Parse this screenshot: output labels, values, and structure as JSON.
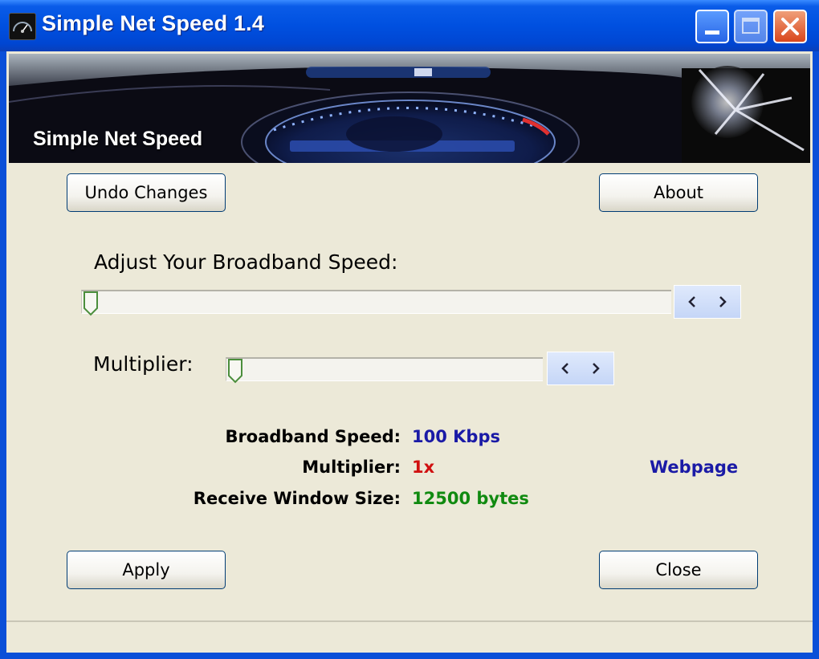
{
  "window": {
    "title": "Simple Net Speed 1.4",
    "icon": "speedometer-app-icon"
  },
  "banner": {
    "title": "Simple Net Speed"
  },
  "buttons": {
    "undo": "Undo Changes",
    "about": "About",
    "apply": "Apply",
    "close": "Close"
  },
  "sliders": {
    "broadband": {
      "label": "Adjust Your Broadband Speed:",
      "value": 0
    },
    "multiplier": {
      "label": "Multiplier:",
      "value": 0
    }
  },
  "info": {
    "broadband_speed": {
      "label": "Broadband Speed:",
      "value": "100 Kbps",
      "color": "#1a1aa6"
    },
    "multiplier": {
      "label": "Multiplier:",
      "value": "1x",
      "color": "#d01010"
    },
    "receive_window": {
      "label": "Receive Window Size:",
      "value": "12500 bytes",
      "color": "#108a10"
    }
  },
  "link": {
    "label": "Webpage"
  },
  "colors": {
    "titlebar": "#0050e0",
    "dialog_bg": "#ece9d8"
  }
}
